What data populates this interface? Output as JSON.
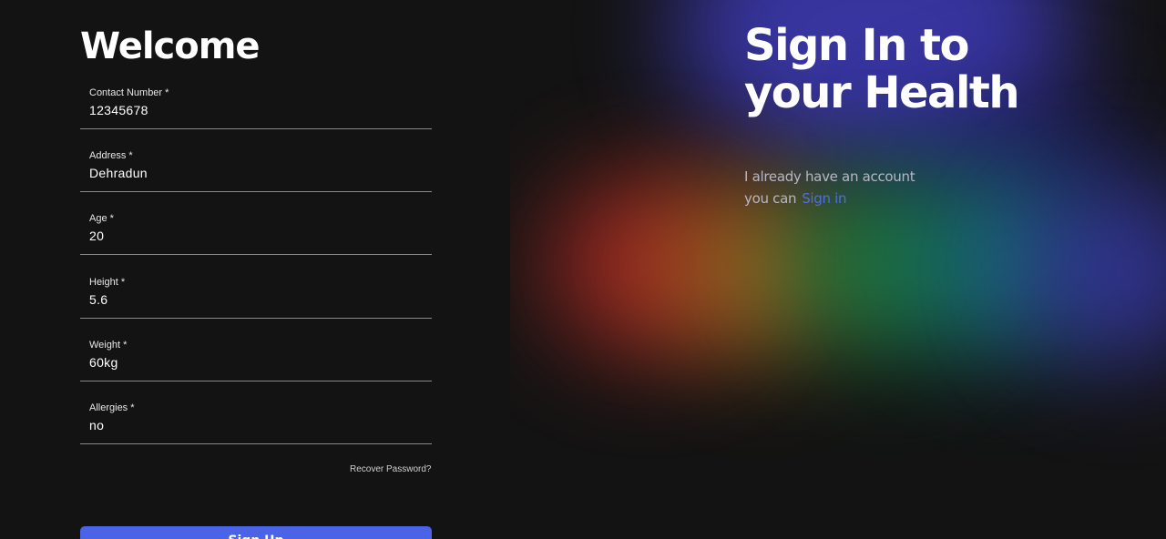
{
  "left": {
    "title": "Welcome",
    "fields": [
      {
        "label": "Contact Number *",
        "value": "12345678"
      },
      {
        "label": "Address *",
        "value": "Dehradun"
      },
      {
        "label": "Age *",
        "value": "20"
      },
      {
        "label": "Height *",
        "value": "5.6"
      },
      {
        "label": "Weight *",
        "value": "60kg"
      },
      {
        "label": "Allergies *",
        "value": "no"
      }
    ],
    "recover_link": "Recover Password?",
    "signup_label": "Sign Up"
  },
  "right": {
    "heading_line1": "Sign In to",
    "heading_line2": "your Health",
    "sub_line1": "I already have an account",
    "sub_line2": "you can",
    "signin_link": "Sign in"
  },
  "colors": {
    "background": "#131313",
    "primary_button": "#4a63e7",
    "link": "#4f6ee0"
  }
}
